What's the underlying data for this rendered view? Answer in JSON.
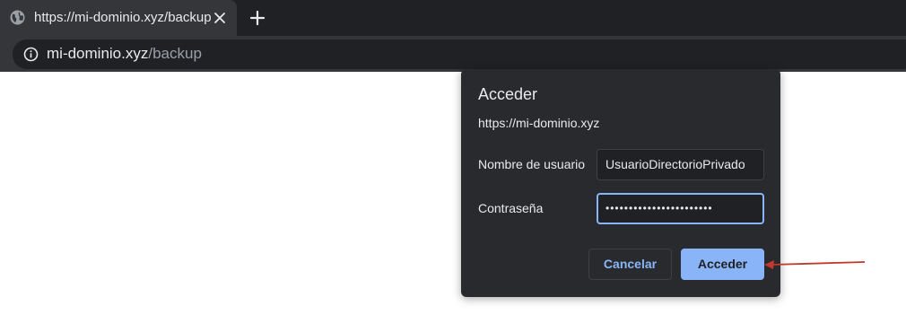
{
  "tab": {
    "title": "https://mi-dominio.xyz/backup"
  },
  "address_bar": {
    "host": "mi-dominio.xyz",
    "path": "/backup"
  },
  "dialog": {
    "title": "Acceder",
    "origin": "https://mi-dominio.xyz",
    "username_label": "Nombre de usuario",
    "username_value": "UsuarioDirectorioPrivado",
    "password_label": "Contraseña",
    "password_value": "•••••••••••••••••••••••",
    "cancel_label": "Cancelar",
    "submit_label": "Acceder"
  },
  "icons": {
    "tab_favicon": "globe-icon",
    "tab_close": "close-icon",
    "new_tab": "plus-icon",
    "site_info": "info-icon",
    "annotation": "arrow-icon"
  },
  "colors": {
    "accent": "#8ab4f8",
    "dialog_bg": "#292a2d",
    "annotation_arrow": "#c0392b"
  }
}
